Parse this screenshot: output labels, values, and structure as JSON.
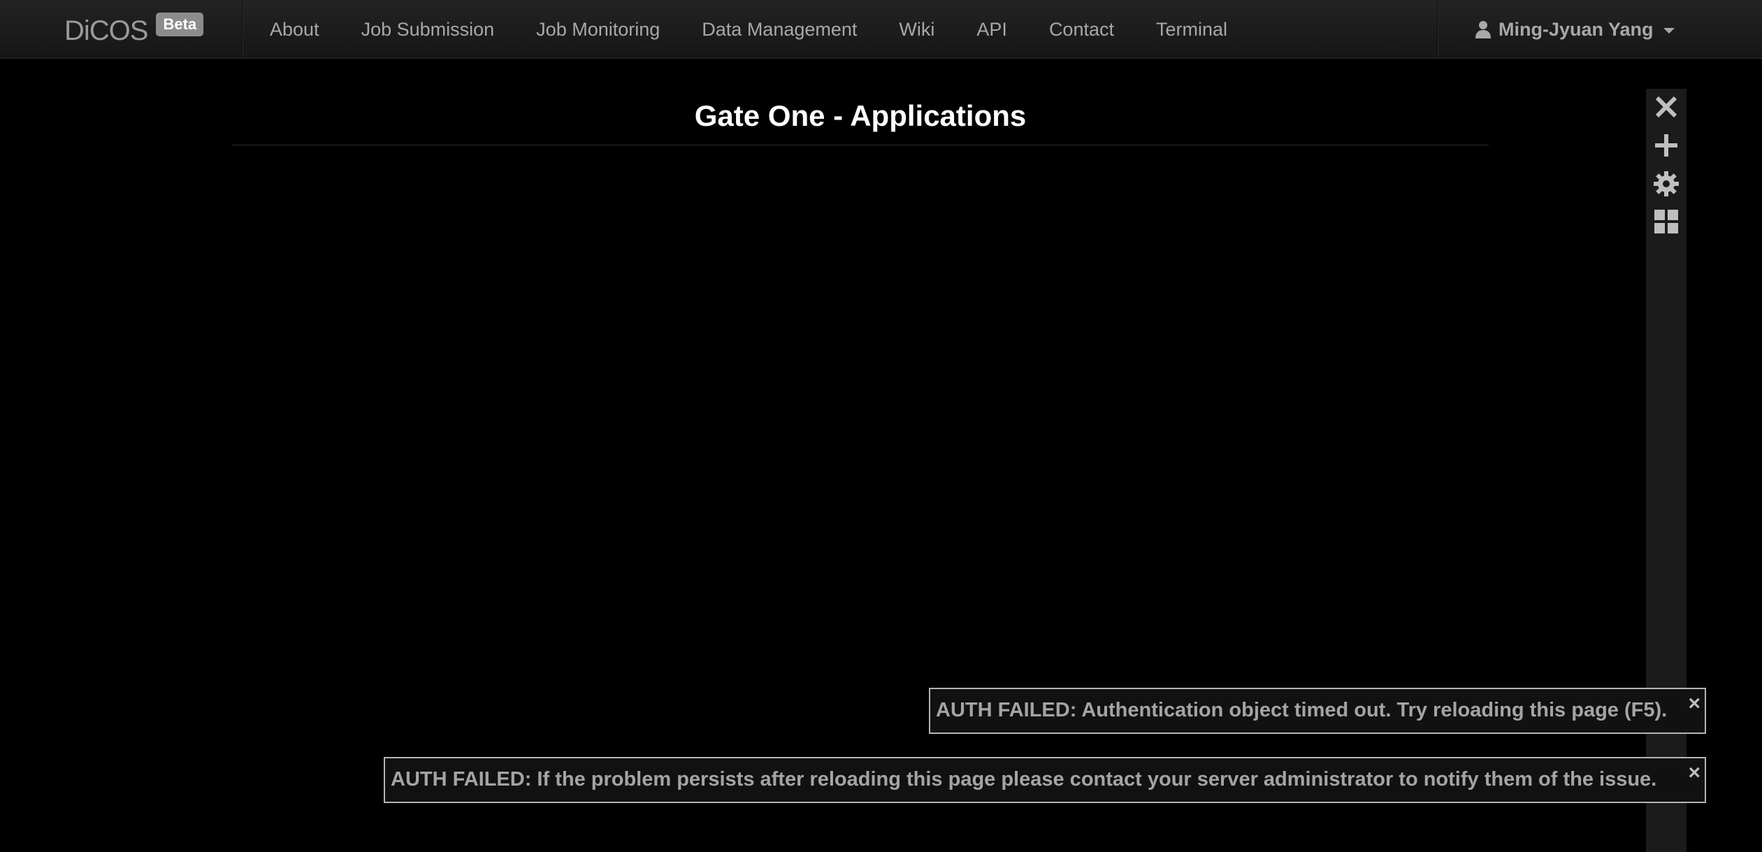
{
  "navbar": {
    "brand": "DiCOS",
    "badge": "Beta",
    "links": [
      "About",
      "Job Submission",
      "Job Monitoring",
      "Data Management",
      "Wiki",
      "API",
      "Contact",
      "Terminal"
    ],
    "user": "Ming-Jyuan Yang"
  },
  "app": {
    "title": "Gate One - Applications"
  },
  "toolbar": {
    "icons": [
      "close-icon",
      "plus-icon",
      "gear-icon",
      "grid-icon"
    ]
  },
  "notices": [
    {
      "text": "AUTH FAILED: Authentication object timed out. Try reloading this page (F5).",
      "close": "×"
    },
    {
      "text": "AUTH FAILED: If the problem persists after reloading this page please contact your server administrator to notify them of the issue.",
      "close": "×"
    }
  ],
  "colors": {
    "background": "#000000",
    "navbar": "#1c1c1c",
    "nav_text": "#a8a8a8",
    "notice_border": "#b5b5b5",
    "toolbar": "#1b1b1b"
  }
}
